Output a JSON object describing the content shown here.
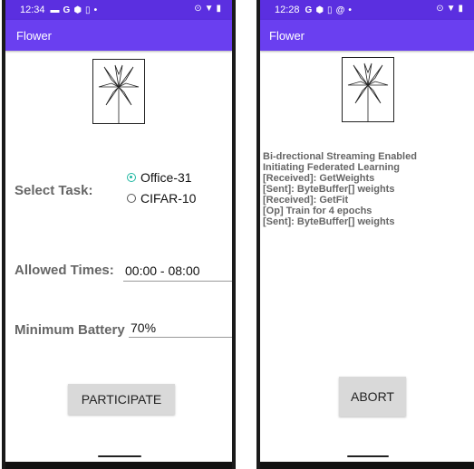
{
  "left_phone": {
    "status": {
      "time": "12:34"
    },
    "appbar": {
      "title": "Flower"
    },
    "task": {
      "label": "Select Task:",
      "options": [
        {
          "label": "Office-31",
          "selected": true
        },
        {
          "label": "CIFAR-10",
          "selected": false
        }
      ]
    },
    "allowed_times": {
      "label": "Allowed Times:",
      "value": "00:00 - 08:00"
    },
    "battery": {
      "label": "Minimum Battery",
      "value": "70%"
    },
    "participate_label": "PARTICIPATE"
  },
  "right_phone": {
    "status": {
      "time": "12:28"
    },
    "appbar": {
      "title": "Flower"
    },
    "log": [
      "Bi-drectional Streaming Enabled",
      "Initiating Federated Learning",
      "[Received]: GetWeights",
      "[Sent]: ByteBuffer[] weights",
      "[Received]: GetFit",
      "[Op] Train for 4 epochs",
      "[Sent]: ByteBuffer[] weights"
    ],
    "abort_label": "ABORT"
  },
  "colors": {
    "status_bar": "#5b2fe0",
    "app_bar": "#6a3ff0",
    "radio_accent": "#20b8a2",
    "button": "#d9d9d9"
  }
}
